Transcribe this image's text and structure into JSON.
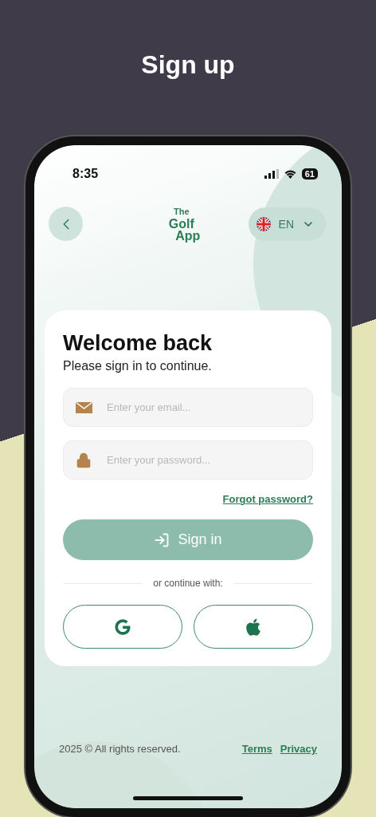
{
  "heading": "Sign up",
  "status_bar": {
    "time": "8:35",
    "battery": "61"
  },
  "nav": {
    "logo": [
      "The",
      "Golf",
      "App"
    ],
    "language": "EN"
  },
  "card": {
    "title": "Welcome back",
    "subtitle": "Please sign in to continue.",
    "fields": [
      {
        "kind": "email",
        "placeholder": "Enter your email..."
      },
      {
        "kind": "password",
        "placeholder": "Enter your password..."
      }
    ],
    "forgot": "Forgot password?",
    "submit": {
      "label": "Sign in",
      "disabled": true
    },
    "divider": "or continue with:",
    "social": [
      {
        "kind": "google"
      },
      {
        "kind": "apple"
      }
    ]
  },
  "footer": {
    "copyright": "2025 © All rights reserved.",
    "links": [
      "Terms",
      "Privacy"
    ]
  }
}
